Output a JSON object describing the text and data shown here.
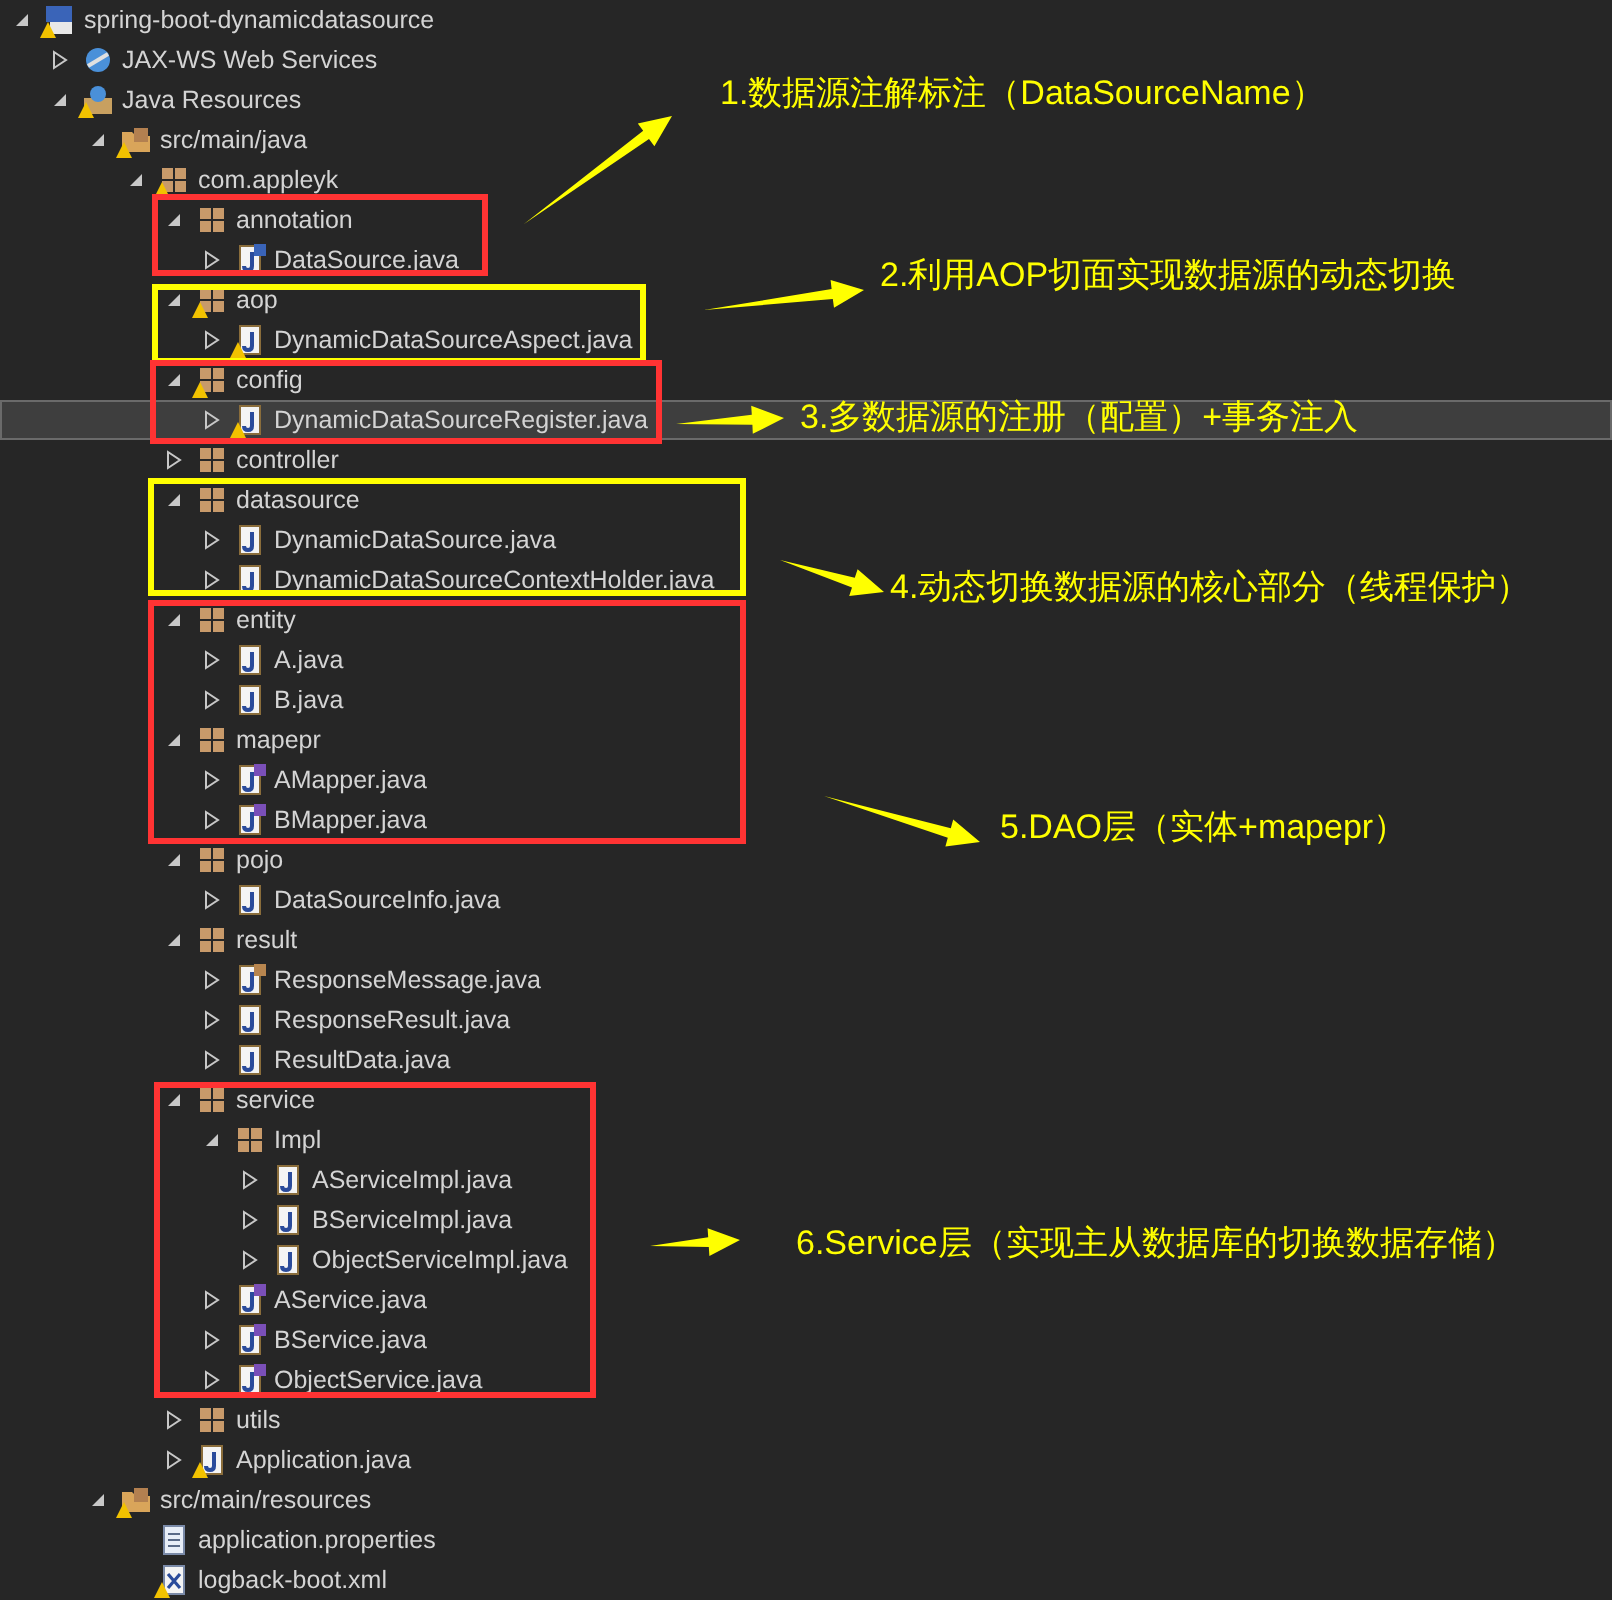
{
  "tree": [
    {
      "kind": "project",
      "label": "spring-boot-dynamicdatasource",
      "expanded": true,
      "warning": true,
      "selected": false,
      "children": [
        {
          "kind": "webservices",
          "label": "JAX-WS Web Services",
          "expanded": false,
          "warning": false,
          "selected": false
        },
        {
          "kind": "resources",
          "label": "Java Resources",
          "expanded": true,
          "warning": true,
          "selected": false,
          "children": [
            {
              "kind": "srcfolder",
              "label": "src/main/java",
              "expanded": true,
              "warning": true,
              "selected": false,
              "children": [
                {
                  "kind": "package",
                  "label": "com.appleyk",
                  "expanded": true,
                  "warning": true,
                  "selected": false,
                  "children": [
                    {
                      "kind": "package",
                      "label": "annotation",
                      "expanded": true,
                      "warning": false,
                      "selected": false,
                      "children": [
                        {
                          "kind": "annotation",
                          "label": "DataSource.java",
                          "expanded": false,
                          "warning": false,
                          "selected": false
                        }
                      ]
                    },
                    {
                      "kind": "package",
                      "label": "aop",
                      "expanded": true,
                      "warning": true,
                      "selected": false,
                      "children": [
                        {
                          "kind": "class",
                          "label": "DynamicDataSourceAspect.java",
                          "expanded": false,
                          "warning": true,
                          "selected": false
                        }
                      ]
                    },
                    {
                      "kind": "package",
                      "label": "config",
                      "expanded": true,
                      "warning": true,
                      "selected": false,
                      "children": [
                        {
                          "kind": "class",
                          "label": "DynamicDataSourceRegister.java",
                          "expanded": false,
                          "warning": true,
                          "selected": true
                        }
                      ]
                    },
                    {
                      "kind": "package",
                      "label": "controller",
                      "expanded": false,
                      "warning": false,
                      "selected": false
                    },
                    {
                      "kind": "package",
                      "label": "datasource",
                      "expanded": true,
                      "warning": false,
                      "selected": false,
                      "children": [
                        {
                          "kind": "class",
                          "label": "DynamicDataSource.java",
                          "expanded": false,
                          "warning": false,
                          "selected": false
                        },
                        {
                          "kind": "class",
                          "label": "DynamicDataSourceContextHolder.java",
                          "expanded": false,
                          "warning": false,
                          "selected": false
                        }
                      ]
                    },
                    {
                      "kind": "package",
                      "label": "entity",
                      "expanded": true,
                      "warning": false,
                      "selected": false,
                      "children": [
                        {
                          "kind": "class",
                          "label": "A.java",
                          "expanded": false,
                          "warning": false,
                          "selected": false
                        },
                        {
                          "kind": "class",
                          "label": "B.java",
                          "expanded": false,
                          "warning": false,
                          "selected": false
                        }
                      ]
                    },
                    {
                      "kind": "package",
                      "label": "mapepr",
                      "expanded": true,
                      "warning": false,
                      "selected": false,
                      "children": [
                        {
                          "kind": "interface",
                          "label": "AMapper.java",
                          "expanded": false,
                          "warning": false,
                          "selected": false
                        },
                        {
                          "kind": "interface",
                          "label": "BMapper.java",
                          "expanded": false,
                          "warning": false,
                          "selected": false
                        }
                      ]
                    },
                    {
                      "kind": "package",
                      "label": "pojo",
                      "expanded": true,
                      "warning": false,
                      "selected": false,
                      "children": [
                        {
                          "kind": "class",
                          "label": "DataSourceInfo.java",
                          "expanded": false,
                          "warning": false,
                          "selected": false
                        }
                      ]
                    },
                    {
                      "kind": "package",
                      "label": "result",
                      "expanded": true,
                      "warning": false,
                      "selected": false,
                      "children": [
                        {
                          "kind": "enum",
                          "label": "ResponseMessage.java",
                          "expanded": false,
                          "warning": false,
                          "selected": false
                        },
                        {
                          "kind": "class",
                          "label": "ResponseResult.java",
                          "expanded": false,
                          "warning": false,
                          "selected": false
                        },
                        {
                          "kind": "class",
                          "label": "ResultData.java",
                          "expanded": false,
                          "warning": false,
                          "selected": false
                        }
                      ]
                    },
                    {
                      "kind": "package",
                      "label": "service",
                      "expanded": true,
                      "warning": false,
                      "selected": false,
                      "children": [
                        {
                          "kind": "package",
                          "label": "Impl",
                          "expanded": true,
                          "warning": false,
                          "selected": false,
                          "children": [
                            {
                              "kind": "class",
                              "label": "AServiceImpl.java",
                              "expanded": false,
                              "warning": false,
                              "selected": false
                            },
                            {
                              "kind": "class",
                              "label": "BServiceImpl.java",
                              "expanded": false,
                              "warning": false,
                              "selected": false
                            },
                            {
                              "kind": "class",
                              "label": "ObjectServiceImpl.java",
                              "expanded": false,
                              "warning": false,
                              "selected": false
                            }
                          ]
                        },
                        {
                          "kind": "interface",
                          "label": "AService.java",
                          "expanded": false,
                          "warning": false,
                          "selected": false
                        },
                        {
                          "kind": "interface",
                          "label": "BService.java",
                          "expanded": false,
                          "warning": false,
                          "selected": false
                        },
                        {
                          "kind": "interface",
                          "label": "ObjectService.java",
                          "expanded": false,
                          "warning": false,
                          "selected": false
                        }
                      ]
                    },
                    {
                      "kind": "package",
                      "label": "utils",
                      "expanded": false,
                      "warning": false,
                      "selected": false
                    },
                    {
                      "kind": "class",
                      "label": "Application.java",
                      "expanded": false,
                      "warning": true,
                      "selected": false
                    }
                  ]
                }
              ]
            },
            {
              "kind": "srcfolder",
              "label": "src/main/resources",
              "expanded": true,
              "warning": true,
              "selected": false,
              "children": [
                {
                  "kind": "properties",
                  "label": "application.properties",
                  "warning": false,
                  "selected": false
                },
                {
                  "kind": "xml",
                  "label": "logback-boot.xml",
                  "warning": true,
                  "selected": false
                }
              ]
            }
          ]
        }
      ]
    }
  ],
  "frames": [
    {
      "color": "#ff3333"
    },
    {
      "color": "#ffff00"
    },
    {
      "color": "#ff3333"
    },
    {
      "color": "#ffff00"
    },
    {
      "color": "#ff3333"
    },
    {
      "color": "#ff3333"
    }
  ],
  "annotations": [
    {
      "text": "1.数据源注解标注（DataSourceName）"
    },
    {
      "text": "2.利用AOP切面实现数据源的动态切换"
    },
    {
      "text": "3.多数据源的注册（配置）+事务注入"
    },
    {
      "text": "4.动态切换数据源的核心部分（线程保护）"
    },
    {
      "text": "5.DAO层（实体+mapepr）"
    },
    {
      "text": "6.Service层（实现主从数据库的切换数据存储）"
    }
  ]
}
